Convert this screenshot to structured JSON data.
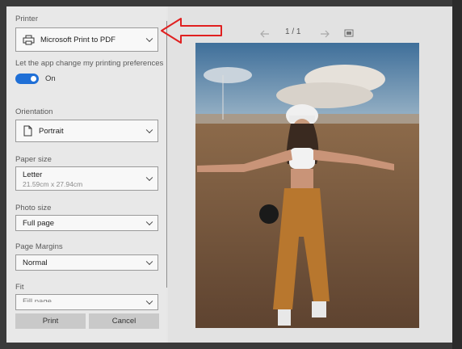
{
  "printer": {
    "label": "Printer",
    "value": "Microsoft Print to PDF"
  },
  "preferences": {
    "label": "Let the app change my printing preferences",
    "toggle_state": "On"
  },
  "orientation": {
    "label": "Orientation",
    "value": "Portrait"
  },
  "paper_size": {
    "label": "Paper size",
    "value": "Letter",
    "dimensions": "21.59cm x 27.94cm"
  },
  "photo_size": {
    "label": "Photo size",
    "value": "Full page"
  },
  "page_margins": {
    "label": "Page Margins",
    "value": "Normal"
  },
  "fit": {
    "label": "Fit",
    "value": "Fill page"
  },
  "actions": {
    "print": "Print",
    "cancel": "Cancel"
  },
  "preview": {
    "page_indicator": "1 / 1",
    "prev_icon": "arrow-left-icon",
    "next_icon": "arrow-right-icon",
    "fit_icon": "fit-page-icon"
  },
  "annotation": {
    "arrow_color": "#e02020"
  },
  "colors": {
    "toggle_on": "#1f6fd6"
  }
}
